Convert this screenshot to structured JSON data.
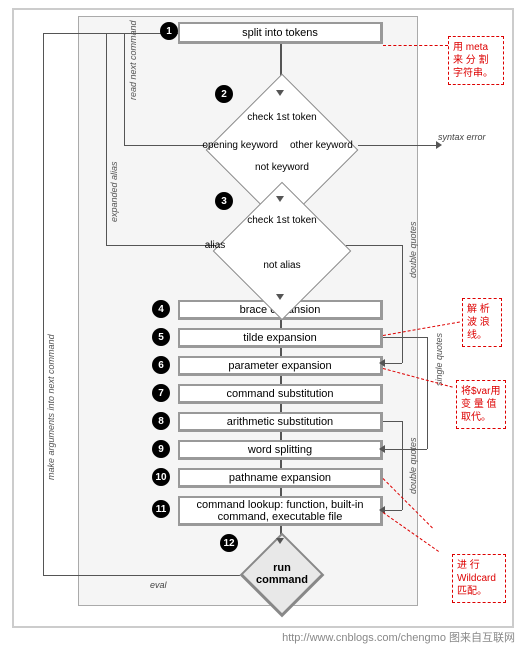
{
  "steps": {
    "s1": "split into tokens",
    "s2": "check 1st token",
    "s2a": "opening keyword",
    "s2b": "other keyword",
    "s2c": "not keyword",
    "s3": "check 1st token",
    "s3a": "alias",
    "s3b": "not alias",
    "s4": "brace expansion",
    "s5": "tilde expansion",
    "s6": "parameter expansion",
    "s7": "command substitution",
    "s8": "arithmetic substitution",
    "s9": "word splitting",
    "s10": "pathname expansion",
    "s11": "command lookup: function, built-in command, executable file",
    "s12a": "run",
    "s12b": "command"
  },
  "side": {
    "read_next": "read next command",
    "expanded_alias": "expanded alias",
    "make_args": "make arguments into next command",
    "double_quotes": "double quotes",
    "single_quotes": "single quotes",
    "double_quotes2": "double quotes",
    "eval": "eval",
    "syntax_error": "syntax error"
  },
  "notes": {
    "n1": "用 meta 来 分 割 字符串。",
    "n2": "解 析 波 浪 线。",
    "n3": "将$var用 变 量 值 取代。",
    "n4": "进 行 Wildcard 匹配。"
  },
  "footer": "http://www.cnblogs.com/chengmo 图来自互联网"
}
